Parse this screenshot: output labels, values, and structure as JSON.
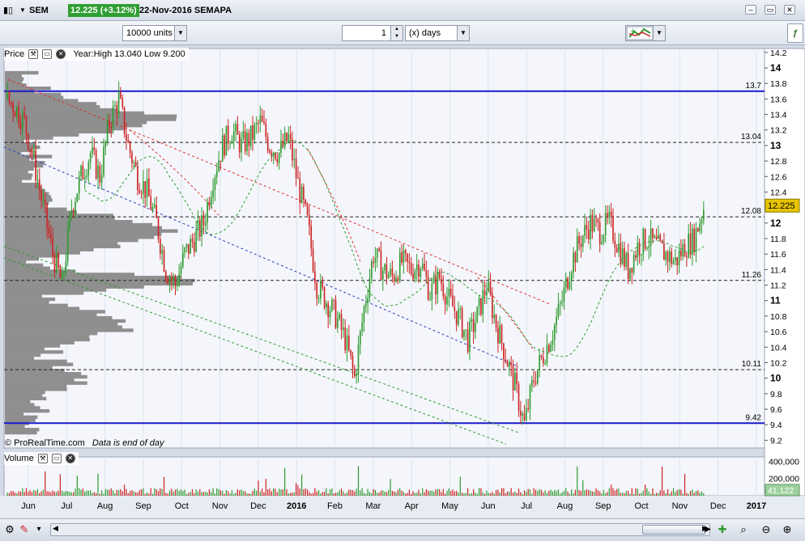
{
  "window": {
    "symbol": "SEM",
    "price_badge": "12.225 (+3.12%)",
    "header_info": "22-Nov-2016 SEMAPA"
  },
  "toolbar": {
    "units_select": "10000 units",
    "period_value": "1",
    "period_unit": "(x) days"
  },
  "price_panel": {
    "label": "Price",
    "info": "Year:High 13.040 Low 9.200",
    "copyright": "© ProRealTime.com",
    "eod_note": "Data is end of day",
    "current_price": "12.225"
  },
  "volume_panel": {
    "label": "Volume",
    "current_volume": "41,122",
    "ticks": [
      "400,000",
      "200,000"
    ]
  },
  "colors": {
    "up": "#2e9a2e",
    "down": "#cc2222",
    "profile": "#8f8f8f",
    "level": "#1a1acc",
    "ma": "#2e9a2e",
    "badge": "#e8c400",
    "trend_red": "#e03030",
    "trend_blue": "#2a3fc0",
    "trend_green": "#2e9a2e"
  },
  "chart_data": {
    "type": "candlestick",
    "y_ticks": [
      "14.2",
      "14",
      "13.8",
      "13.6",
      "13.4",
      "13.2",
      "13",
      "12.8",
      "12.6",
      "12.4",
      "12.2",
      "12",
      "11.8",
      "11.6",
      "11.4",
      "11.2",
      "11",
      "10.8",
      "10.6",
      "10.4",
      "10.2",
      "10",
      "9.8",
      "9.6",
      "9.4",
      "9.2"
    ],
    "ylim": [
      9.1,
      14.25
    ],
    "x_labels": [
      "Jun",
      "Jul",
      "Aug",
      "Sep",
      "Oct",
      "Nov",
      "Dec",
      "2016",
      "Feb",
      "Mar",
      "Apr",
      "May",
      "Jun",
      "Jul",
      "Aug",
      "Sep",
      "Oct",
      "Nov",
      "Dec",
      "2017"
    ],
    "horizontal_levels": [
      {
        "label": "13.7",
        "value": 13.7,
        "style": "solid"
      },
      {
        "label": "13.04",
        "value": 13.04,
        "style": "dashed"
      },
      {
        "label": "12.08",
        "value": 12.08,
        "style": "dashed"
      },
      {
        "label": "11.26",
        "value": 11.26,
        "style": "dashed"
      },
      {
        "label": "10.11",
        "value": 10.11,
        "style": "dashed"
      },
      {
        "label": "9.42",
        "value": 9.42,
        "style": "solid"
      }
    ],
    "price_path": [
      13.6,
      13.5,
      13.3,
      12.8,
      12.2,
      11.6,
      11.2,
      12.2,
      12.6,
      12.9,
      12.6,
      13.3,
      13.6,
      13.0,
      12.6,
      12.4,
      12.0,
      11.4,
      11.2,
      11.6,
      11.8,
      12.0,
      12.6,
      13.0,
      13.2,
      13.0,
      13.1,
      13.3,
      13.0,
      12.9,
      13.1,
      12.5,
      12.0,
      11.2,
      11.0,
      10.8,
      10.5,
      10.0,
      10.9,
      11.6,
      11.4,
      11.3,
      11.5,
      11.4,
      11.5,
      11.1,
      11.3,
      11.0,
      10.8,
      10.5,
      10.8,
      11.2,
      10.7,
      10.3,
      9.9,
      9.4,
      10.0,
      10.3,
      10.6,
      11.0,
      11.5,
      11.8,
      12.0,
      11.9,
      12.0,
      11.7,
      11.4,
      11.7,
      11.8,
      11.7,
      11.6,
      11.5,
      11.7,
      11.8,
      12.2
    ],
    "volume_profile_note": "horizontal volume-at-price histogram on left",
    "volume_y_range": [
      0,
      450000
    ]
  }
}
